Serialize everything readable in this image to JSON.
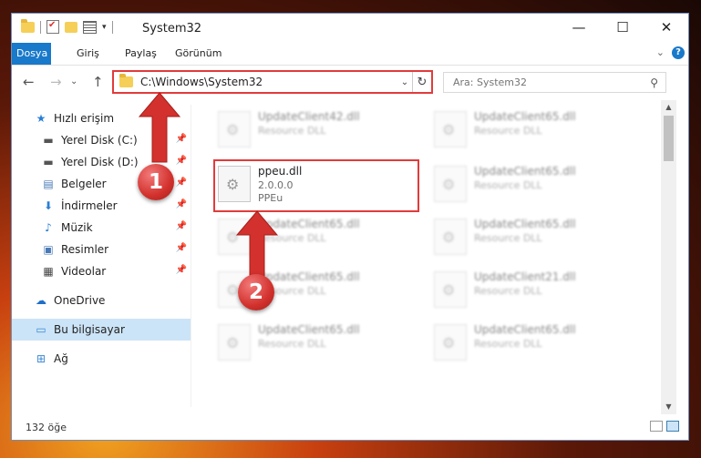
{
  "window": {
    "title": "System32",
    "controls": {
      "minimize": "—",
      "maximize": "☐",
      "close": "✕"
    }
  },
  "ribbon": {
    "tabs": [
      "Dosya",
      "Giriş",
      "Paylaş",
      "Görünüm"
    ],
    "collapse": "⌄",
    "help": "?"
  },
  "nav": {
    "back": "←",
    "forward": "→",
    "recent": "⌄",
    "up": "↑",
    "address": "C:\\Windows\\System32",
    "address_drop": "⌄",
    "refresh": "↻",
    "search_placeholder": "Ara: System32"
  },
  "sidebar": {
    "quick_access": "Hızlı erişim",
    "items": [
      {
        "label": "Yerel Disk (C:)",
        "icon": "drive-icon",
        "pinned": true
      },
      {
        "label": "Yerel Disk (D:)",
        "icon": "drive-icon",
        "pinned": true
      },
      {
        "label": "Belgeler",
        "icon": "documents-icon",
        "pinned": true
      },
      {
        "label": "İndirmeler",
        "icon": "downloads-icon",
        "pinned": true
      },
      {
        "label": "Müzik",
        "icon": "music-icon",
        "pinned": true
      },
      {
        "label": "Resimler",
        "icon": "pictures-icon",
        "pinned": true
      },
      {
        "label": "Videolar",
        "icon": "videos-icon",
        "pinned": true
      }
    ],
    "onedrive": "OneDrive",
    "this_pc": "Bu bilgisayar",
    "network": "Ağ"
  },
  "files": [
    {
      "name": "UpdateClient42.dll",
      "desc": "Resource DLL"
    },
    {
      "name": "UpdateClient65.dll",
      "desc": "Resource DLL"
    },
    {
      "name": "ppeu.dll",
      "version": "2.0.0.0",
      "desc": "PPEu"
    },
    {
      "name": "UpdateClient65.dll",
      "desc": "Resource DLL"
    },
    {
      "name": "UpdateClient65.dll",
      "desc": "Resource DLL"
    },
    {
      "name": "UpdateClient65.dll",
      "desc": "Resource DLL"
    },
    {
      "name": "UpdateClient65.dll",
      "desc": "Resource DLL"
    },
    {
      "name": "UpdateClient21.dll",
      "desc": "Resource DLL"
    },
    {
      "name": "UpdateClient65.dll",
      "desc": "Resource DLL"
    },
    {
      "name": "UpdateClient65.dll",
      "desc": "Resource DLL"
    }
  ],
  "status": {
    "count": "132 öğe"
  },
  "annotations": {
    "step1": "1",
    "step2": "2",
    "color": "#e23b3b"
  }
}
